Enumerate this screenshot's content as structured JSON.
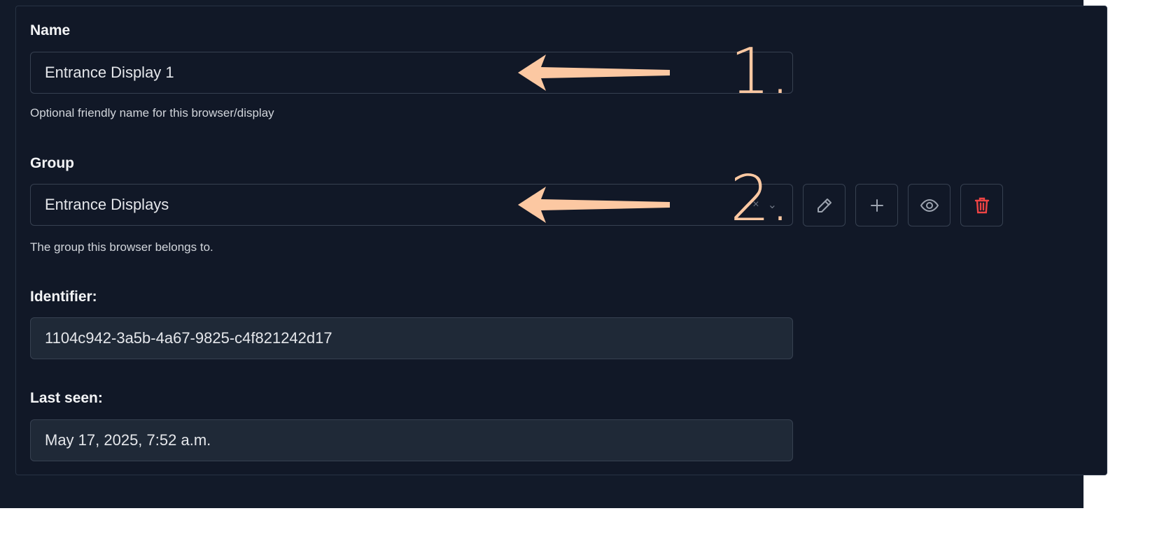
{
  "form": {
    "name": {
      "label": "Name",
      "value": "Entrance Display 1",
      "help": "Optional friendly name for this browser/display"
    },
    "group": {
      "label": "Group",
      "value": "Entrance Displays",
      "help": "The group this browser belongs to.",
      "clear_glyph": "×",
      "dropdown_glyph": "⌄",
      "actions": [
        "pencil-icon",
        "plus-icon",
        "eye-icon",
        "trash-icon"
      ]
    },
    "identifier": {
      "label": "Identifier:",
      "value": "1104c942-3a5b-4a67-9825-c4f821242d17"
    },
    "last_seen": {
      "label": "Last seen:",
      "value": "May 17, 2025, 7:52 a.m."
    }
  },
  "annotations": [
    {
      "number": "1."
    },
    {
      "number": "2."
    }
  ],
  "colors": {
    "background": "#121a29",
    "annotation": "#fcc8a2",
    "danger": "#ef4444"
  }
}
